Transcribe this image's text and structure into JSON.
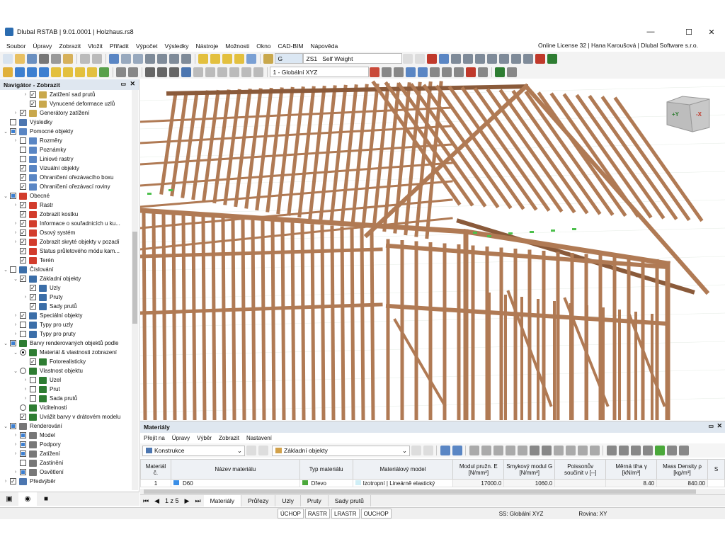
{
  "window": {
    "title": "Dlubal RSTAB | 9.01.0001 | Holzhaus.rs8",
    "minimize": "—",
    "maximize": "☐",
    "close": "✕"
  },
  "menu": [
    "Soubor",
    "Úpravy",
    "Zobrazit",
    "Vložit",
    "Přiřadit",
    "Výpočet",
    "Výsledky",
    "Nástroje",
    "Možnosti",
    "Okno",
    "CAD-BIM",
    "Nápověda"
  ],
  "license": "Online License 32 | Hana Karoušová | Dlubal Software s.r.o.",
  "toolbar": {
    "load_case_badge": "G",
    "load_case": "ZS1",
    "load_case_name": "Self Weight",
    "coord_system": "1 - Globální XYZ"
  },
  "navigator": {
    "title": "Navigátor - Zobrazit",
    "items": [
      {
        "label": "Zatížení sad prutů",
        "indent": 3,
        "exp": ">",
        "cb": "on",
        "icon": "load"
      },
      {
        "label": "Vynucené deformace uzlů",
        "indent": 3,
        "exp": "",
        "cb": "on",
        "icon": "load"
      },
      {
        "label": "Generátory zatížení",
        "indent": 2,
        "exp": ">",
        "cb": "on",
        "icon": "load"
      },
      {
        "label": "Výsledky",
        "indent": 1,
        "exp": "",
        "cb": "off",
        "icon": "result"
      },
      {
        "label": "Pomocné objekty",
        "indent": 1,
        "exp": "v",
        "cb": "part",
        "icon": "helper"
      },
      {
        "label": "Rozměry",
        "indent": 2,
        "exp": ">",
        "cb": "off",
        "icon": "helper"
      },
      {
        "label": "Poznámky",
        "indent": 2,
        "exp": "",
        "cb": "off",
        "icon": "helper"
      },
      {
        "label": "Liniové rastry",
        "indent": 2,
        "exp": "",
        "cb": "off",
        "icon": "helper"
      },
      {
        "label": "Vizuální objekty",
        "indent": 2,
        "exp": "",
        "cb": "on",
        "icon": "helper"
      },
      {
        "label": "Ohraničení ořezávacího boxu",
        "indent": 2,
        "exp": "",
        "cb": "on",
        "icon": "helper"
      },
      {
        "label": "Ohraničení ořezávací roviny",
        "indent": 2,
        "exp": "",
        "cb": "on",
        "icon": "helper"
      },
      {
        "label": "Obecné",
        "indent": 1,
        "exp": "v",
        "cb": "part",
        "icon": "general"
      },
      {
        "label": "Rastr",
        "indent": 2,
        "exp": ">",
        "cb": "on",
        "icon": "general"
      },
      {
        "label": "Zobrazit kostku",
        "indent": 2,
        "exp": "",
        "cb": "on",
        "icon": "general"
      },
      {
        "label": "Informace o souřadnicích u ku...",
        "indent": 2,
        "exp": ">",
        "cb": "on",
        "icon": "general"
      },
      {
        "label": "Osový systém",
        "indent": 2,
        "exp": ">",
        "cb": "on",
        "icon": "general"
      },
      {
        "label": "Zobrazit skryté objekty v pozadí",
        "indent": 2,
        "exp": ">",
        "cb": "on",
        "icon": "general"
      },
      {
        "label": "Status průletového módu kam...",
        "indent": 2,
        "exp": "",
        "cb": "on",
        "icon": "general"
      },
      {
        "label": "Terén",
        "indent": 2,
        "exp": "",
        "cb": "on",
        "icon": "general"
      },
      {
        "label": "Číslování",
        "indent": 1,
        "exp": "v",
        "cb": "off",
        "icon": "num"
      },
      {
        "label": "Základní objekty",
        "indent": 2,
        "exp": "v",
        "cb": "on",
        "icon": "num"
      },
      {
        "label": "Uzly",
        "indent": 3,
        "exp": "",
        "cb": "on",
        "icon": "num"
      },
      {
        "label": "Pruty",
        "indent": 3,
        "exp": ">",
        "cb": "on",
        "icon": "num"
      },
      {
        "label": "Sady prutů",
        "indent": 3,
        "exp": "",
        "cb": "on",
        "icon": "num"
      },
      {
        "label": "Speciální objekty",
        "indent": 2,
        "exp": ">",
        "cb": "on",
        "icon": "num"
      },
      {
        "label": "Typy pro uzly",
        "indent": 2,
        "exp": ">",
        "cb": "off",
        "icon": "num"
      },
      {
        "label": "Typy pro pruty",
        "indent": 2,
        "exp": ">",
        "cb": "off",
        "icon": "num"
      },
      {
        "label": "Barvy renderovaných objektů podle",
        "indent": 1,
        "exp": "v",
        "cb": "part",
        "icon": "color"
      },
      {
        "label": "Materiál & vlastnosti zobrazení",
        "indent": 2,
        "exp": "v",
        "rad": "on",
        "icon": "color"
      },
      {
        "label": "Fotorealisticky",
        "indent": 3,
        "exp": "",
        "cb": "on",
        "icon": "color"
      },
      {
        "label": "Vlastnost objektu",
        "indent": 2,
        "exp": "v",
        "rad": "off",
        "icon": "color"
      },
      {
        "label": "Uzel",
        "indent": 3,
        "exp": ">",
        "cb": "off",
        "icon": "color"
      },
      {
        "label": "Prut",
        "indent": 3,
        "exp": ">",
        "cb": "off",
        "icon": "color"
      },
      {
        "label": "Sada prutů",
        "indent": 3,
        "exp": ">",
        "cb": "off",
        "icon": "color"
      },
      {
        "label": "Viditelnosti",
        "indent": 2,
        "exp": "",
        "rad": "off",
        "icon": "color"
      },
      {
        "label": "Uvážit barvy v drátovém modelu",
        "indent": 2,
        "exp": "",
        "cb": "on",
        "icon": "color"
      },
      {
        "label": "Renderování",
        "indent": 1,
        "exp": "v",
        "cb": "part",
        "icon": "render"
      },
      {
        "label": "Model",
        "indent": 2,
        "exp": ">",
        "cb": "part",
        "icon": "render"
      },
      {
        "label": "Podpory",
        "indent": 2,
        "exp": ">",
        "cb": "part",
        "icon": "render"
      },
      {
        "label": "Zatížení",
        "indent": 2,
        "exp": ">",
        "cb": "part",
        "icon": "render"
      },
      {
        "label": "Zastínění",
        "indent": 2,
        "exp": "",
        "cb": "off",
        "icon": "render"
      },
      {
        "label": "Osvětlení",
        "indent": 2,
        "exp": ">",
        "cb": "part",
        "icon": "render"
      },
      {
        "label": "Předvýběr",
        "indent": 1,
        "exp": ">",
        "cb": "on",
        "icon": "pre"
      }
    ]
  },
  "viewcube": {
    "plus_y": "+Y",
    "minus_x": "-X"
  },
  "panel": {
    "title": "Materiály",
    "menu": [
      "Přejít na",
      "Úpravy",
      "Výběr",
      "Zobrazit",
      "Nastavení"
    ],
    "filter1": "Konstrukce",
    "filter2": "Základní objekty",
    "columns": [
      "Materiál č.",
      "Název materiálu",
      "Typ materiálu",
      "Materiálový model",
      "Modul pružn. E [N/mm²]",
      "Smykový modul G [N/mm²]",
      "Poissonův součinit ν [--]",
      "Měrná tíha γ [kN/m³]",
      "Mass Density ρ [kg/m³]",
      "S"
    ],
    "rows": [
      {
        "no": "1",
        "name": "D60",
        "type": "Dřevo",
        "model": "Izotropní | Lineárně elastický",
        "E": "17000.0",
        "G": "1060.0",
        "nu": "",
        "gamma": "8.40",
        "rho": "840.00"
      }
    ],
    "pager": "1 z 5",
    "tabs": [
      "Materiály",
      "Průřezy",
      "Uzly",
      "Pruty",
      "Sady prutů"
    ]
  },
  "status": {
    "buttons": [
      "ÚCHOP",
      "RASTR",
      "LRASTR",
      "OUCHOP"
    ],
    "ss": "SS: Globální XYZ",
    "plane": "Rovina: XY"
  },
  "colors": {
    "wood": "#b07a54",
    "wood_dark": "#8a5a3a",
    "accent": "#3c7fd1",
    "material_blue": "#3a8ee6",
    "material_green": "#4aa83a"
  }
}
